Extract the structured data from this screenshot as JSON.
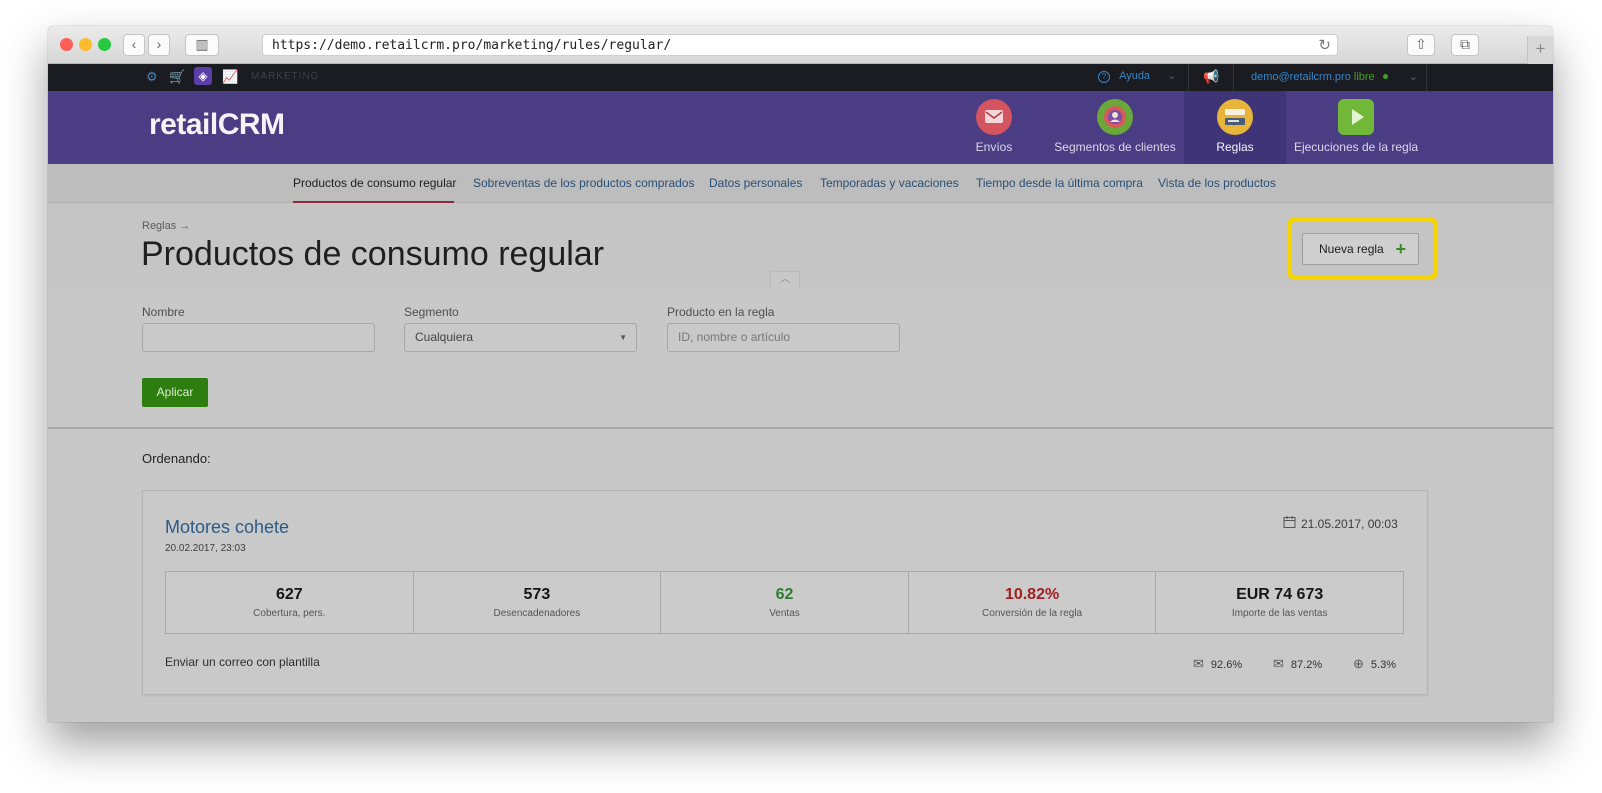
{
  "browser": {
    "url": "https://demo.retailcrm.pro/marketing/rules/regular/",
    "icons": {
      "back": "chevron-left-icon",
      "forward": "chevron-right-icon",
      "sidebar": "sidebar-icon",
      "reload": "reload-icon",
      "share": "share-icon",
      "tabs": "tabs-icon",
      "new_tab": "plus-icon"
    },
    "glyphs": {
      "back": "‹",
      "forward": "›",
      "sidebar": "▥",
      "reload": "↻",
      "share": "⇧",
      "tabs": "⧉",
      "new_tab": "+"
    }
  },
  "topbar": {
    "module_label": "MARKETING",
    "help_label": "Ayuda",
    "user_email": "demo@retailcrm.pro",
    "user_status": "libre",
    "status_color": "#3fa321",
    "glyphs": {
      "settings": "⚙",
      "cart": "🛒",
      "module": "◈",
      "analytics": "📈",
      "help": "?",
      "chevron": "⌄",
      "megaphone": "📢"
    }
  },
  "header": {
    "logo": "retailCRM",
    "nav": [
      {
        "label": "Envíos",
        "icon": "envelope-icon",
        "color": "#d4545f"
      },
      {
        "label": "Segmentos de clientes",
        "icon": "segments-icon",
        "color": "#6aa83a"
      },
      {
        "label": "Reglas",
        "icon": "rules-icon",
        "color": "#e8b43a",
        "active": true
      },
      {
        "label": "Ejecuciones de la regla",
        "icon": "play-icon",
        "color": "#71b838"
      }
    ]
  },
  "subnav": {
    "tabs": [
      "Productos de consumo regular",
      "Sobreventas de los productos comprados",
      "Datos personales",
      "Temporadas y vacaciones",
      "Tiempo desde la última compra",
      "Vista de los productos"
    ],
    "active_index": 0
  },
  "page": {
    "breadcrumb": "Reglas →",
    "title": "Productos de consumo regular",
    "new_rule_label": "Nueva regla",
    "new_rule_plus": "+",
    "collapse_glyph": "︿",
    "highlight_color": "#f7d500"
  },
  "filters": {
    "name_label": "Nombre",
    "name_value": "",
    "segment_label": "Segmento",
    "segment_value": "Cualquiera",
    "product_label": "Producto en la regla",
    "product_placeholder": "ID, nombre o artículo",
    "apply_label": "Aplicar",
    "apply_color": "#2e7d0f"
  },
  "list": {
    "sorting_label": "Ordenando:",
    "rules": [
      {
        "name": "Motores cohete",
        "created": "20.02.2017, 23:03",
        "updated": "21.05.2017, 00:03",
        "calendar_glyph": "📅",
        "stats": [
          {
            "value": "627",
            "label": "Cobertura, pers.",
            "color": "#161616"
          },
          {
            "value": "573",
            "label": "Desencadenadores",
            "color": "#161616"
          },
          {
            "value": "62",
            "label": "Ventas",
            "color": "#2f7d2f"
          },
          {
            "value": "10.82%",
            "label": "Conversión de la regla",
            "color": "#a12020"
          },
          {
            "value": "EUR 74 673",
            "label": "Importe de las ventas",
            "color": "#161616"
          }
        ],
        "action": "Enviar un correo con plantilla",
        "metrics": [
          {
            "icon": "envelope-icon",
            "glyph": "✉",
            "value": "92.6%"
          },
          {
            "icon": "envelope-open-icon",
            "glyph": "✉",
            "value": "87.2%"
          },
          {
            "icon": "target-icon",
            "glyph": "⊕",
            "value": "5.3%"
          }
        ]
      }
    ]
  }
}
